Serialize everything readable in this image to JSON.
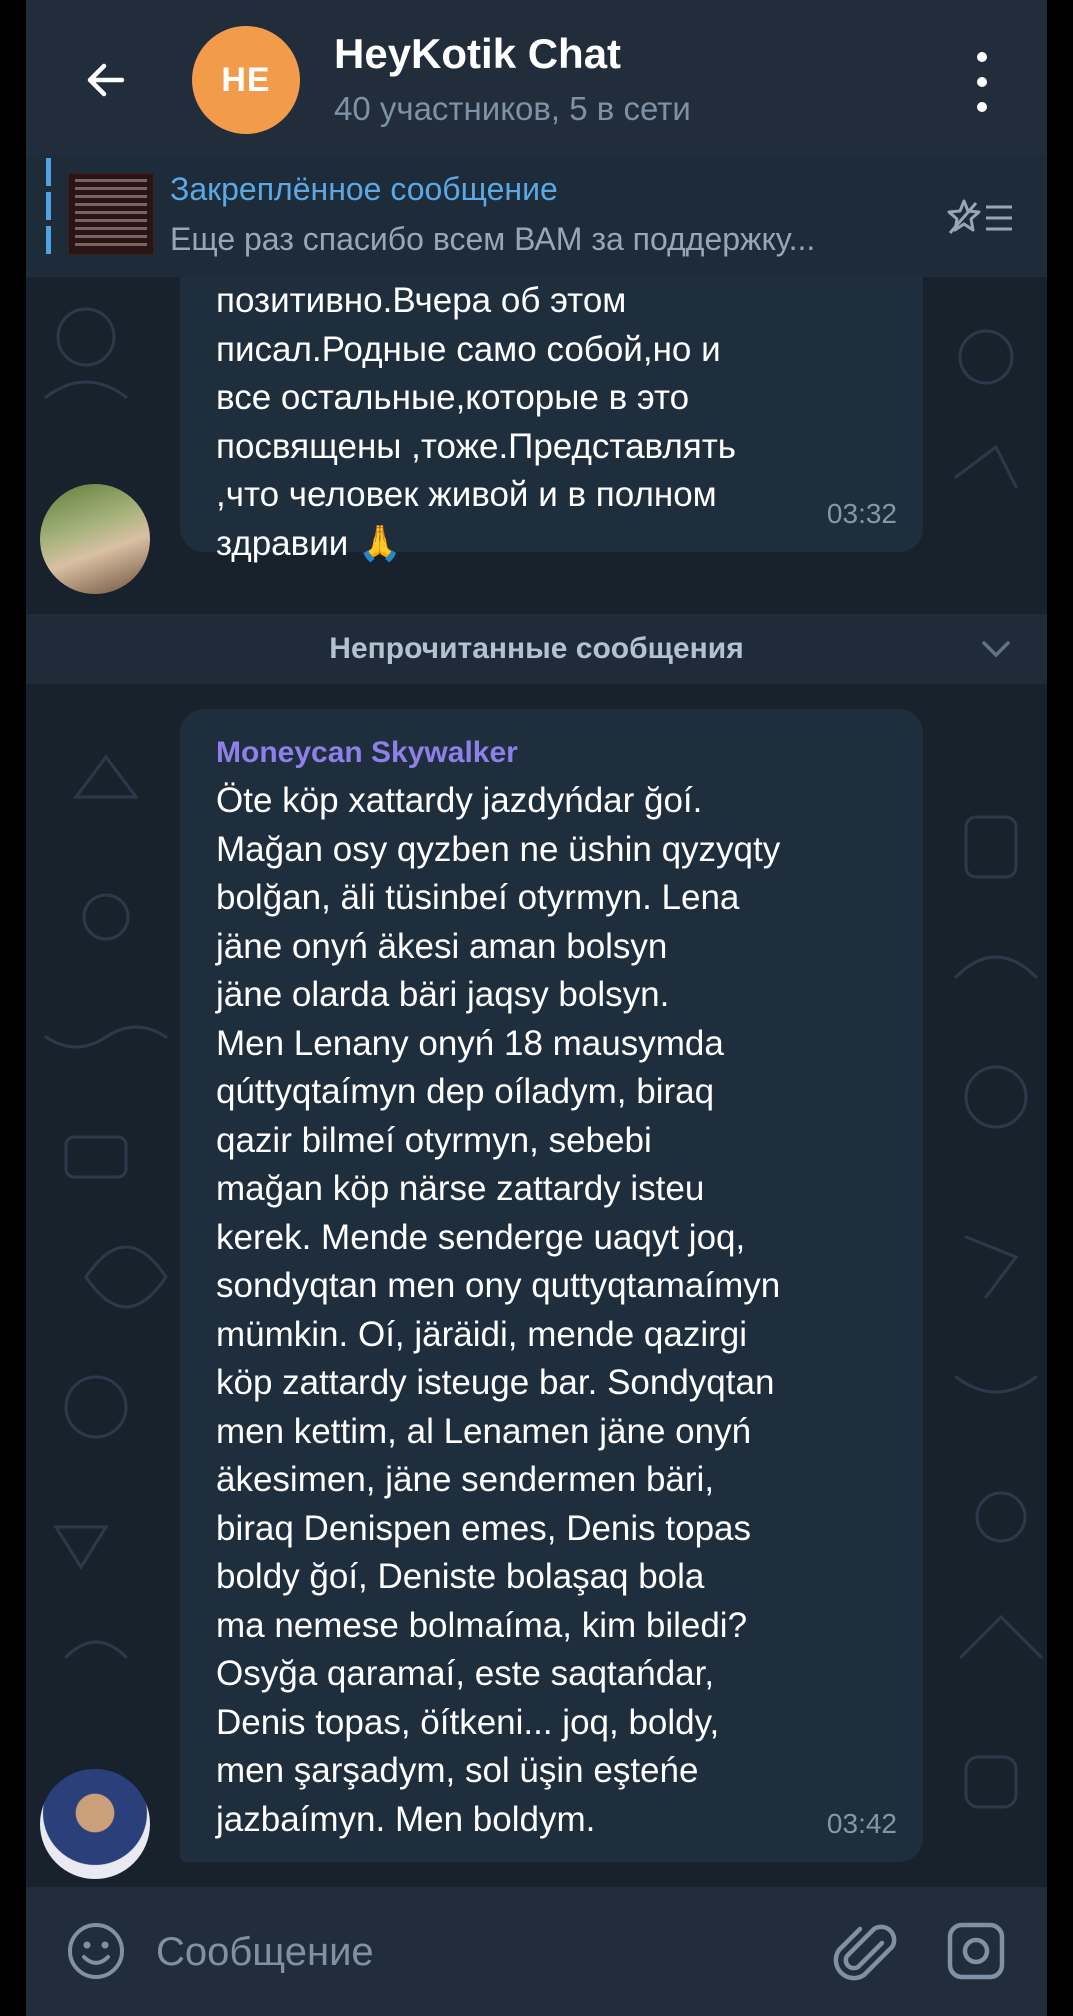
{
  "header": {
    "back_icon": "arrow-left-icon",
    "avatar_initials": "HE",
    "title": "HeyKotik Chat",
    "subtitle": "40 участников, 5 в сети",
    "menu_icon": "more-vertical-icon",
    "avatar_color": "#f29b4b"
  },
  "pinned": {
    "title": "Закреплённое сообщение",
    "text": "Еще раз спасибо всем ВАМ за поддержку...",
    "icon": "unpin-list-icon"
  },
  "messages": [
    {
      "text": "позитивно.Вчера об этом\nписал.Родные само собой,но и\nвсе остальные,которые в это\nпосвящены ,тоже.Представлять\n,что человек живой и в полном\nздравии 🙏",
      "time": "03:32"
    },
    {
      "sender": "Moneycan Skywalker",
      "text": "Öte köp xattardy jazdyńdar ğoí.\nMağan osy qyzben ne üshin qyzyqty\nbolğan, äli tüsinbeí otyrmyn. Lena\njäne onyń äkesi aman bolsyn\njäne olarda bäri jaqsy bolsyn.\nMen Lenany onyń 18 mausymda\nqúttyqtaímyn dep oíladym, biraq\nqazir bilmeí otyrmyn, sebebi\nmağan köp närse zattardy isteu\nkerek. Mende senderge uaqyt joq,\nsondyqtan men ony quttyqtamaímyn\nmümkin. Oí, järäidi, mende qazirgi\nköp zattardy isteuge bar. Sondyqtan\nmen kettim, al Lenamen jäne onyń\näkesimen, jäne sendermen bäri,\nbiraq Denispen emes, Denis topas\nboldy ğoí, Deniste bolaşaq bola\nma nemese bolmaíma, kim biledi?\nOsyğa qaramaí, este saqtańdar,\nDenis topas, öítkeni... joq, boldy,\nmen şarşadym, sol üşin eşteńe\njazbaímyn. Men boldym.",
      "time": "03:42",
      "sender_color": "#8e7fe9"
    }
  ],
  "unread_label": "Непрочитанные сообщения",
  "input": {
    "placeholder": "Сообщение",
    "emoji_icon": "emoji-smile-icon",
    "attach_icon": "paperclip-icon",
    "camera_icon": "camera-icon"
  },
  "colors": {
    "background": "#18222d",
    "header": "#212d3b",
    "bubble": "#1f2e3d",
    "accent": "#5aa9e6"
  }
}
